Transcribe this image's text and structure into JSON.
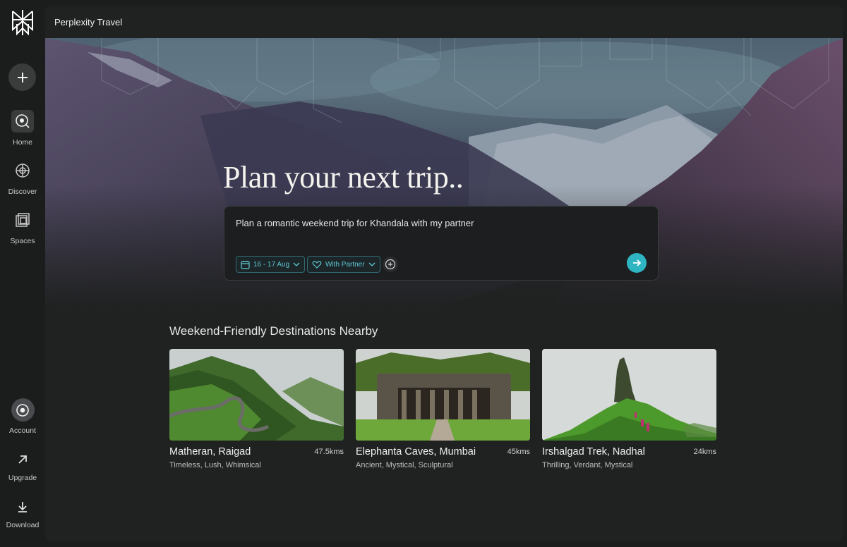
{
  "sidebar": {
    "new_thread_icon": "plus-icon",
    "items": [
      {
        "label": "Home",
        "icon": "compass-icon",
        "active": true
      },
      {
        "label": "Discover",
        "icon": "globe-icon"
      },
      {
        "label": "Spaces",
        "icon": "spaces-icon"
      }
    ],
    "bottom": [
      {
        "label": "Account",
        "icon": "account-icon"
      },
      {
        "label": "Upgrade",
        "icon": "arrow-up-right-icon"
      },
      {
        "label": "Download",
        "icon": "download-icon"
      }
    ]
  },
  "header": {
    "title": "Perplexity Travel"
  },
  "hero": {
    "title": "Plan your next trip.."
  },
  "prompt": {
    "text": "Plan a romantic weekend trip for Khandala with my partner",
    "date_chip": "16 - 17 Aug",
    "companion_chip": "With Partner"
  },
  "destinations": {
    "title": "Weekend-Friendly Destinations Nearby",
    "cards": [
      {
        "name": "Matheran, Raigad",
        "distance": "47.5kms",
        "tags": "Timeless, Lush, Whimsical"
      },
      {
        "name": "Elephanta Caves, Mumbai",
        "distance": "45kms",
        "tags": "Ancient, Mystical, Sculptural"
      },
      {
        "name": "Irshalgad Trek, Nadhal",
        "distance": "24kms",
        "tags": "Thrilling, Verdant, Mystical"
      }
    ]
  },
  "colors": {
    "accent": "#2fb4c2",
    "background": "#202222",
    "sidebar": "#1b1c1c"
  }
}
